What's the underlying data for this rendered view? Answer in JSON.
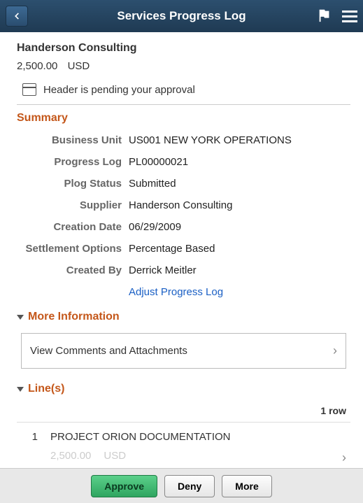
{
  "header": {
    "title": "Services Progress Log"
  },
  "top": {
    "supplier_name": "Handerson Consulting",
    "amount": "2,500.00",
    "currency": "USD",
    "approval_msg": "Header is pending your approval"
  },
  "summary": {
    "title": "Summary",
    "fields": {
      "business_unit": {
        "label": "Business Unit",
        "value": "US001 NEW YORK OPERATIONS"
      },
      "progress_log": {
        "label": "Progress Log",
        "value": "PL00000021"
      },
      "plog_status": {
        "label": "Plog Status",
        "value": "Submitted"
      },
      "supplier": {
        "label": "Supplier",
        "value": "Handerson Consulting"
      },
      "creation_date": {
        "label": "Creation Date",
        "value": "06/29/2009"
      },
      "settlement_options": {
        "label": "Settlement Options",
        "value": "Percentage Based"
      },
      "created_by": {
        "label": "Created By",
        "value": "Derrick Meitler"
      }
    },
    "adjust_link": "Adjust Progress Log"
  },
  "more_info": {
    "title": "More Information",
    "view_comments": "View Comments and Attachments"
  },
  "lines": {
    "title": "Line(s)",
    "row_count": "1 row",
    "items": [
      {
        "num": "1",
        "desc": "PROJECT ORION DOCUMENTATION",
        "amount": "2,500.00",
        "currency": "USD"
      }
    ]
  },
  "footer": {
    "approve": "Approve",
    "deny": "Deny",
    "more": "More"
  }
}
